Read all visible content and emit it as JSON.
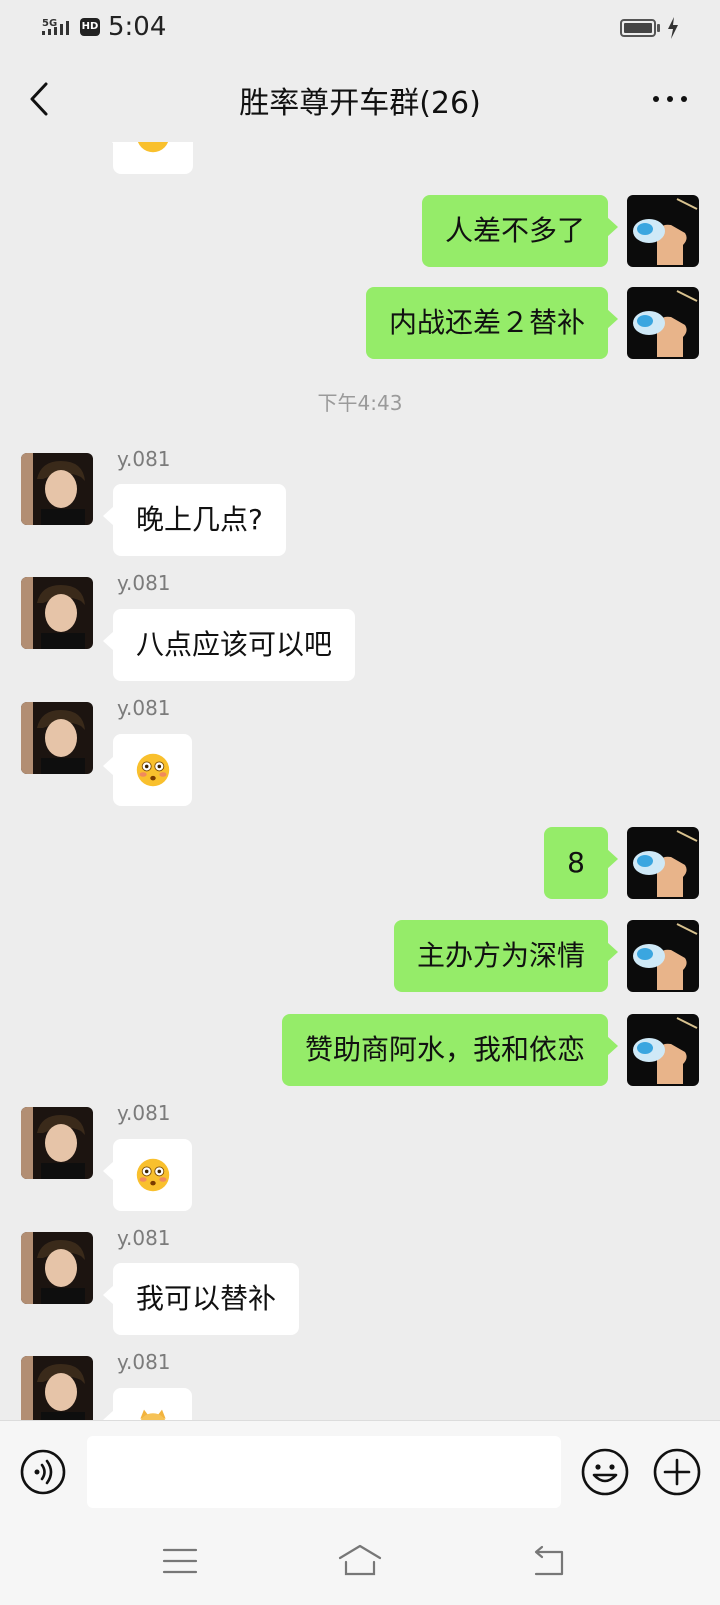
{
  "status_bar": {
    "network": "5G",
    "hd": "HD",
    "time": "5:04"
  },
  "header": {
    "title": "胜率尊开车群(26)"
  },
  "chat": {
    "timestamp": "下午4:43",
    "sender_name": "y.081",
    "outgoing_1": "人差不多了",
    "outgoing_2": "内战还差２替补",
    "incoming_1": "晚上几点?",
    "incoming_2": "八点应该可以吧",
    "outgoing_3": "8",
    "outgoing_4": "主办方为深情",
    "outgoing_5": "赞助商阿水，我和依恋",
    "incoming_5": "我可以替补"
  },
  "input": {
    "value": "",
    "placeholder": ""
  },
  "colors": {
    "outgoing_bubble": "#95ec69",
    "incoming_bubble": "#ffffff",
    "background": "#ededed"
  },
  "icons": {
    "back": "chevron-left-icon",
    "more": "more-dots-icon",
    "voice": "voice-icon",
    "emoji": "smiley-icon",
    "plus": "plus-icon",
    "sys_menu": "menu-icon",
    "sys_home": "home-icon",
    "sys_back": "back-arrow-icon"
  }
}
